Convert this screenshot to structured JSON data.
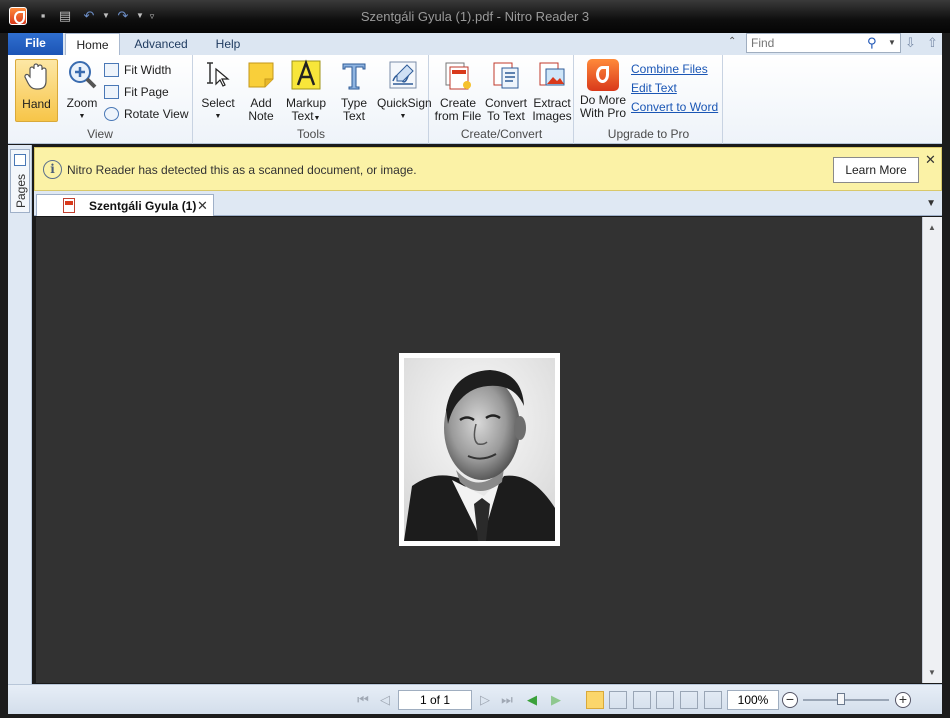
{
  "window": {
    "title": "Szentgáli Gyula (1).pdf - Nitro Reader 3"
  },
  "ribbon_tabs": {
    "file": "File",
    "home": "Home",
    "advanced": "Advanced",
    "help": "Help"
  },
  "search": {
    "placeholder": "Find"
  },
  "groups": {
    "view": {
      "label": "View",
      "hand": "Hand",
      "zoom": "Zoom",
      "fit_width": "Fit Width",
      "fit_page": "Fit Page",
      "rotate_view": "Rotate View"
    },
    "tools": {
      "label": "Tools",
      "select": "Select",
      "add_note": [
        "Add",
        "Note"
      ],
      "markup_text": [
        "Markup",
        "Text"
      ],
      "type_text": [
        "Type",
        "Text"
      ],
      "quicksign": "QuickSign"
    },
    "create_convert": {
      "label": "Create/Convert",
      "create_from_file": [
        "Create",
        "from File"
      ],
      "convert_to_text": [
        "Convert",
        "To Text"
      ],
      "extract_images": [
        "Extract",
        "Images"
      ]
    },
    "upgrade": {
      "label": "Upgrade to Pro",
      "do_more": [
        "Do More",
        "With Pro"
      ],
      "links": [
        "Combine Files",
        "Edit Text",
        "Convert to Word"
      ]
    }
  },
  "sidebar": {
    "pages_label": "Pages"
  },
  "notification": {
    "text": "Nitro Reader has detected this as a scanned document, or image.",
    "button": "Learn More"
  },
  "document_tab": {
    "label": "Szentgáli Gyula (1)"
  },
  "statusbar": {
    "page_display": "1 of 1",
    "zoom": "100%"
  },
  "colors": {
    "file_tab": "#1c54b5",
    "notice_bg": "#fbf2a6",
    "viewer_bg": "#323232",
    "accent_hand": "#f9d56b"
  }
}
